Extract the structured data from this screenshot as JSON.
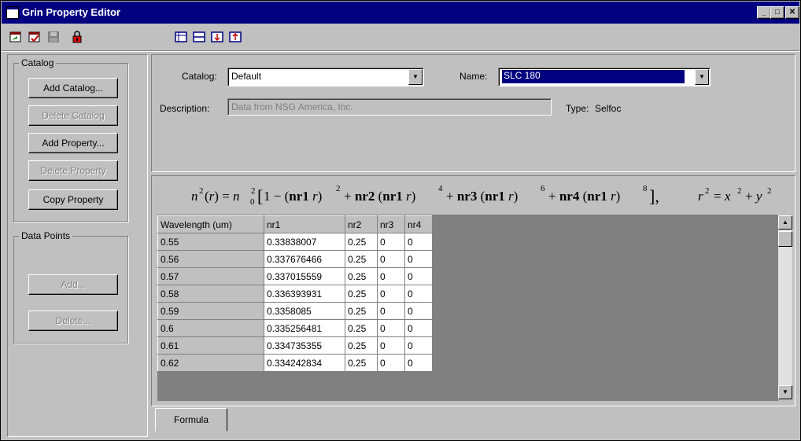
{
  "window": {
    "title": "Grin Property Editor",
    "accent": "#000080"
  },
  "caption_buttons": {
    "minimize": "_",
    "maximize": "□",
    "close": "✕"
  },
  "toolbar": {
    "icons": [
      "open-catalog-icon",
      "edit-catalog-icon",
      "save-icon",
      "lock-icon",
      "insert-row-icon",
      "delete-row-icon",
      "move-down-icon",
      "move-up-icon"
    ]
  },
  "catalog_group": {
    "legend": "Catalog",
    "add_catalog": "Add Catalog...",
    "delete_catalog": "Delete Catalog",
    "add_property": "Add  Property...",
    "delete_property": "Delete Property",
    "copy_property": "Copy Property"
  },
  "data_points_group": {
    "legend": "Data Points",
    "add": "Add...",
    "delete": "Delete..."
  },
  "form": {
    "catalog_label": "Catalog:",
    "catalog_value": "Default",
    "name_label": "Name:",
    "name_value": "SLC 180",
    "description_label": "Description:",
    "description_value": "Data from NSG America, Inc.",
    "type_label": "Type:",
    "type_value": "Selfoc"
  },
  "table": {
    "columns": [
      "Wavelength (um)",
      "nr1",
      "nr2",
      "nr3",
      "nr4"
    ],
    "rows": [
      [
        "0.55",
        "0.33838007",
        "0.25",
        "0",
        "0"
      ],
      [
        "0.56",
        "0.337676466",
        "0.25",
        "0",
        "0"
      ],
      [
        "0.57",
        "0.337015559",
        "0.25",
        "0",
        "0"
      ],
      [
        "0.58",
        "0.336393931",
        "0.25",
        "0",
        "0"
      ],
      [
        "0.59",
        "0.3358085",
        "0.25",
        "0",
        "0"
      ],
      [
        "0.6",
        "0.335256481",
        "0.25",
        "0",
        "0"
      ],
      [
        "0.61",
        "0.334735355",
        "0.25",
        "0",
        "0"
      ],
      [
        "0.62",
        "0.334242834",
        "0.25",
        "0",
        "0"
      ]
    ]
  },
  "tabs": {
    "formula": "Formula"
  }
}
